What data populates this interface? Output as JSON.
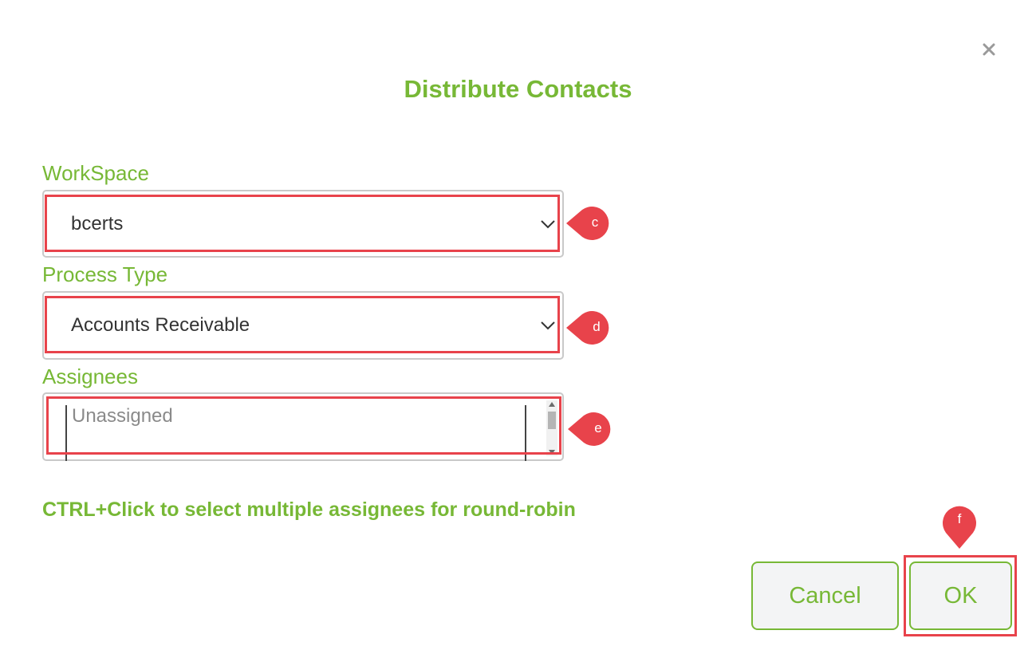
{
  "dialog": {
    "title": "Distribute Contacts"
  },
  "workspace": {
    "label": "WorkSpace",
    "value": "bcerts"
  },
  "process_type": {
    "label": "Process Type",
    "value": "Accounts Receivable"
  },
  "assignees": {
    "label": "Assignees",
    "options": [
      "Unassigned"
    ]
  },
  "hint": "CTRL+Click to select multiple assignees for round-robin",
  "buttons": {
    "cancel": "Cancel",
    "ok": "OK"
  },
  "callouts": {
    "c": "c",
    "d": "d",
    "e": "e",
    "f": "f"
  },
  "colors": {
    "accent": "#77b836",
    "highlight": "#e8434b"
  },
  "icons": {
    "close": "close-icon",
    "dropdown": "chevron-down-icon"
  }
}
